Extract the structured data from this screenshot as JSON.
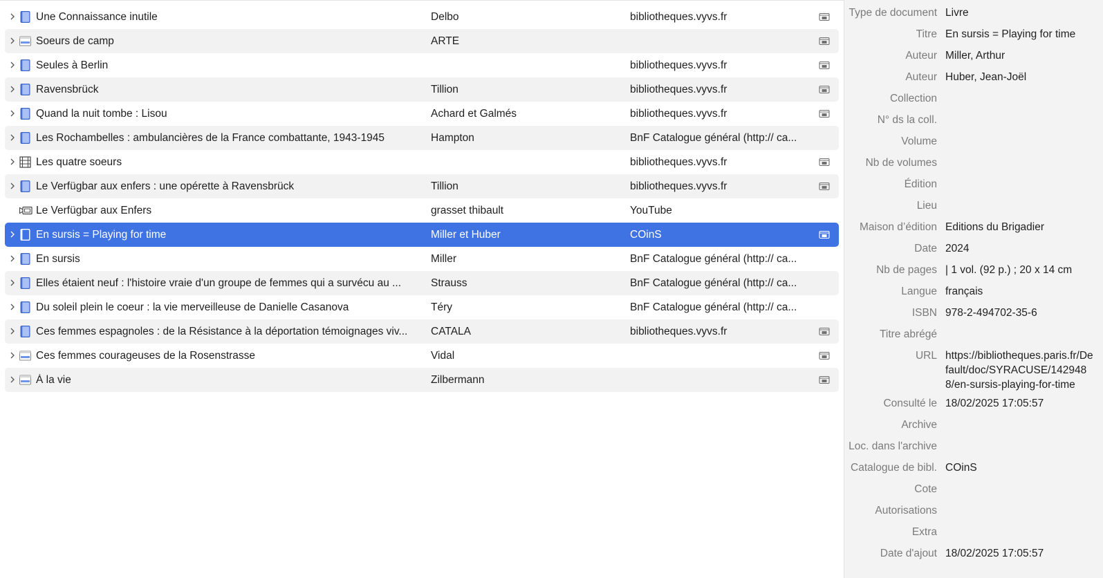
{
  "colors": {
    "accent": "#3f72e2",
    "alt_row": "#f2f2f2",
    "info_bg": "#f3f3f3",
    "label_text": "#7b7b7b"
  },
  "items": [
    {
      "title": "Une Connaissance inutile",
      "creator": "Delbo",
      "source": "bibliotheques.vyvs.fr",
      "type_icon": "book-icon",
      "expandable": true,
      "attachment": true,
      "selected": false
    },
    {
      "title": "Soeurs de camp",
      "creator": "ARTE",
      "source": "",
      "type_icon": "webpage-icon",
      "expandable": true,
      "attachment": true,
      "selected": false
    },
    {
      "title": "Seules à Berlin",
      "creator": "",
      "source": "bibliotheques.vyvs.fr",
      "type_icon": "book-icon",
      "expandable": true,
      "attachment": true,
      "selected": false
    },
    {
      "title": "Ravensbrück",
      "creator": "Tillion",
      "source": "bibliotheques.vyvs.fr",
      "type_icon": "book-icon",
      "expandable": true,
      "attachment": true,
      "selected": false
    },
    {
      "title": "Quand la nuit tombe : Lisou",
      "creator": "Achard et Galmés",
      "source": "bibliotheques.vyvs.fr",
      "type_icon": "book-icon",
      "expandable": true,
      "attachment": true,
      "selected": false
    },
    {
      "title": "Les Rochambelles : ambulancières de la France combattante, 1943-1945",
      "creator": "Hampton",
      "source": "BnF Catalogue général (http:// ca...",
      "type_icon": "book-icon",
      "expandable": true,
      "attachment": false,
      "selected": false
    },
    {
      "title": "Les quatre soeurs",
      "creator": "",
      "source": "bibliotheques.vyvs.fr",
      "type_icon": "film-icon",
      "expandable": true,
      "attachment": true,
      "selected": false
    },
    {
      "title": "Le Verfügbar aux enfers : une opérette à Ravensbrück",
      "creator": "Tillion",
      "source": "bibliotheques.vyvs.fr",
      "type_icon": "book-icon",
      "expandable": true,
      "attachment": true,
      "selected": false
    },
    {
      "title": "Le Verfügbar aux Enfers",
      "creator": "grasset thibault",
      "source": "YouTube",
      "type_icon": "video-icon",
      "expandable": false,
      "attachment": false,
      "selected": false
    },
    {
      "title": "En sursis = Playing for time",
      "creator": "Miller et Huber",
      "source": "COinS",
      "type_icon": "book-icon",
      "expandable": true,
      "attachment": true,
      "selected": true
    },
    {
      "title": "En sursis",
      "creator": "Miller",
      "source": "BnF Catalogue général (http:// ca...",
      "type_icon": "book-icon",
      "expandable": true,
      "attachment": false,
      "selected": false
    },
    {
      "title": "Elles étaient neuf : l'histoire vraie d'un groupe de femmes qui a survécu au ...",
      "creator": "Strauss",
      "source": "BnF Catalogue général (http:// ca...",
      "type_icon": "book-icon",
      "expandable": true,
      "attachment": false,
      "selected": false
    },
    {
      "title": "Du soleil plein le coeur : la vie merveilleuse de Danielle Casanova",
      "creator": "Téry",
      "source": "BnF Catalogue général (http:// ca...",
      "type_icon": "book-icon",
      "expandable": true,
      "attachment": false,
      "selected": false
    },
    {
      "title": "Ces femmes espagnoles : de la Résistance à la déportation témoignages viv...",
      "creator": "CATALA",
      "source": "bibliotheques.vyvs.fr",
      "type_icon": "book-icon",
      "expandable": true,
      "attachment": true,
      "selected": false
    },
    {
      "title": "Ces femmes courageuses de la Rosenstrasse",
      "creator": "Vidal",
      "source": "",
      "type_icon": "webpage-icon",
      "expandable": true,
      "attachment": true,
      "selected": false
    },
    {
      "title": "À la vie",
      "creator": "Zilbermann",
      "source": "",
      "type_icon": "webpage-icon",
      "expandable": true,
      "attachment": true,
      "selected": false
    }
  ],
  "info": {
    "fields": [
      {
        "label": "Type de document",
        "value": "Livre"
      },
      {
        "label": "Titre",
        "value": "En sursis = Playing for time"
      },
      {
        "label": "Auteur",
        "value": "Miller, Arthur"
      },
      {
        "label": "Auteur",
        "value": "Huber, Jean-Joël"
      },
      {
        "label": "Collection",
        "value": ""
      },
      {
        "label": "N° ds la coll.",
        "value": ""
      },
      {
        "label": "Volume",
        "value": ""
      },
      {
        "label": "Nb de volumes",
        "value": ""
      },
      {
        "label": "Édition",
        "value": ""
      },
      {
        "label": "Lieu",
        "value": ""
      },
      {
        "label": "Maison d’édition",
        "value": "Editions du Brigadier"
      },
      {
        "label": "Date",
        "value": "2024"
      },
      {
        "label": "Nb de pages",
        "value": "| 1 vol. (92 p.) ; 20 x 14 cm"
      },
      {
        "label": "Langue",
        "value": "français"
      },
      {
        "label": "ISBN",
        "value": "978-2-494702-35-6"
      },
      {
        "label": "Titre abrégé",
        "value": ""
      },
      {
        "label": "URL",
        "value": "https://bibliotheques.paris.fr/Default/doc/SYRACUSE/1429488/en-sursis-playing-for-time"
      },
      {
        "label": "Consulté le",
        "value": "18/02/2025 17:05:57"
      },
      {
        "label": "Archive",
        "value": ""
      },
      {
        "label": "Loc. dans l'archive",
        "value": ""
      },
      {
        "label": "Catalogue de bibl.",
        "value": "COinS"
      },
      {
        "label": "Cote",
        "value": ""
      },
      {
        "label": "Autorisations",
        "value": ""
      },
      {
        "label": "Extra",
        "value": ""
      },
      {
        "label": "Date d'ajout",
        "value": "18/02/2025 17:05:57"
      }
    ]
  }
}
